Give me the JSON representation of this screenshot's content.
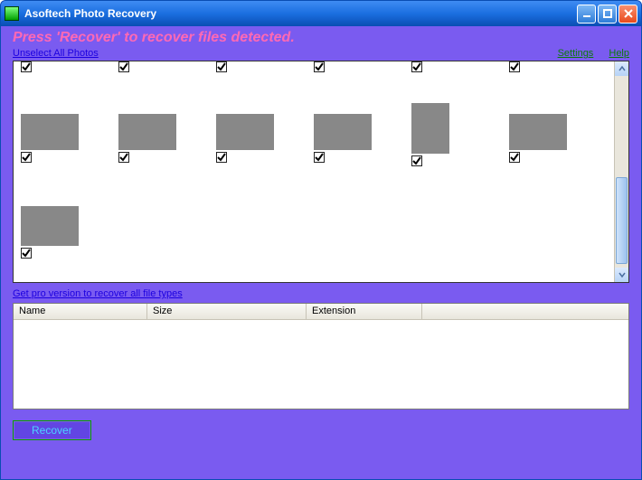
{
  "window": {
    "title": "Asoftech Photo Recovery"
  },
  "header": {
    "instruction": "Press 'Recover' to recover files detected.",
    "unselect_link": "Unselect All Photos",
    "settings_link": "Settings",
    "help_link": "Help"
  },
  "thumbs": {
    "top_row_count": 6,
    "row2": [
      {
        "checked": true,
        "kind": "ph1"
      },
      {
        "checked": true,
        "kind": "ph2"
      },
      {
        "checked": true,
        "kind": "ph3"
      },
      {
        "checked": true,
        "kind": "ph4"
      },
      {
        "checked": true,
        "kind": "ph5"
      },
      {
        "checked": true,
        "kind": "ph6"
      }
    ],
    "row3": [
      {
        "checked": true,
        "kind": "ph7"
      }
    ]
  },
  "pro_link": "Get pro version to recover all file types",
  "table": {
    "columns": {
      "name": "Name",
      "size": "Size",
      "extension": "Extension"
    },
    "rows": []
  },
  "buttons": {
    "recover": "Recover"
  }
}
